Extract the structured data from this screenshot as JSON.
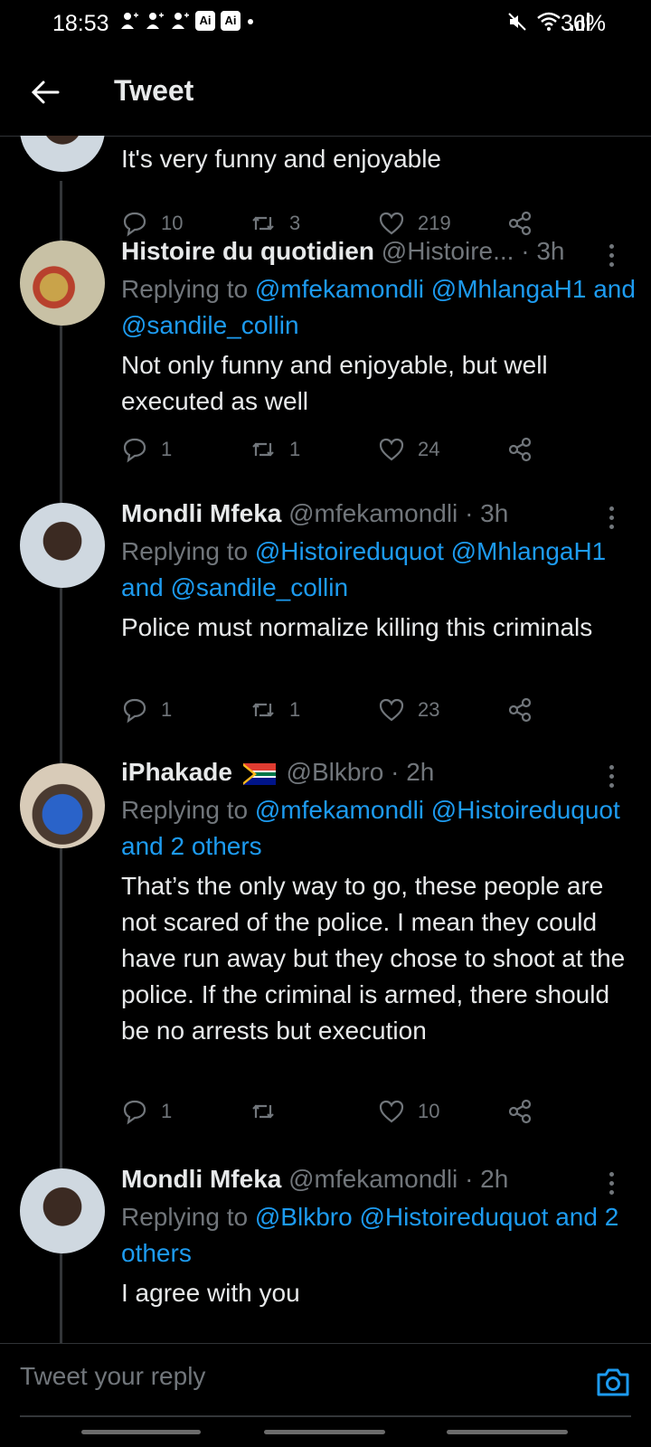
{
  "status_bar": {
    "time": "18:53",
    "battery": "36%",
    "badge_1": "Ai",
    "badge_2": "Ai"
  },
  "header": {
    "title": "Tweet"
  },
  "tweets": [
    {
      "text": "It's very funny and enjoyable",
      "replies": "10",
      "retweets": "3",
      "likes": "219"
    },
    {
      "name": "Histoire du quotidien",
      "handle": "@Histoire...",
      "time": "3h",
      "replying_prefix": "Replying to",
      "replying_to": "@mfekamondli @MhlangaH1 and @sandile_collin",
      "text": "Not only funny and enjoyable, but well executed as well",
      "replies": "1",
      "retweets": "1",
      "likes": "24"
    },
    {
      "name": "Mondli Mfeka",
      "handle": "@mfekamondli",
      "time": "3h",
      "replying_prefix": "Replying to",
      "replying_to": "@Histoireduquot @MhlangaH1 and @sandile_collin",
      "text": "Police must normalize killing this criminals",
      "replies": "1",
      "retweets": "1",
      "likes": "23"
    },
    {
      "name": "iPhakade",
      "handle": "@Blkbro",
      "time": "2h",
      "replying_prefix": "Replying to",
      "replying_to": "@mfekamondli @Histoireduquot and 2 others",
      "text": "That’s the only way to go, these people are not scared of the police. I mean they could have run away but they chose to shoot at the police. If the criminal is armed, there should be no arrests but execution",
      "replies": "1",
      "retweets": "",
      "likes": "10"
    },
    {
      "name": "Mondli Mfeka",
      "handle": "@mfekamondli",
      "time": "2h",
      "replying_prefix": "Replying to",
      "replying_to": "@Blkbro @Histoireduquot and 2 others",
      "text": "I agree with you"
    }
  ],
  "reply_bar": {
    "placeholder": "Tweet your reply"
  },
  "separator": "·"
}
